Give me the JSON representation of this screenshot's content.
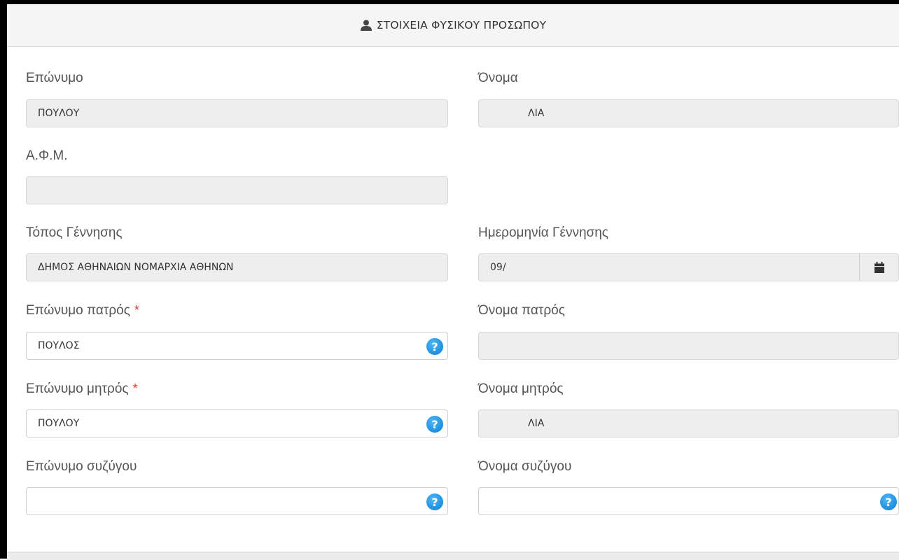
{
  "panel": {
    "title": "ΣΤΟΙΧΕΙΑ ΦΥΣΙΚΟΥ ΠΡΟΣΩΠΟΥ",
    "icon": "user-icon"
  },
  "fields": {
    "surname": {
      "label": "Επώνυμο",
      "value": "ΠΟΥΛΟΥ"
    },
    "first_name": {
      "label": "Όνομα",
      "value": "ΛΙΑ"
    },
    "afm": {
      "label": "Α.Φ.Μ.",
      "value": ""
    },
    "birth_place": {
      "label": "Τόπος Γέννησης",
      "value": "ΔΗΜΟΣ ΑΘΗΝΑΙΩΝ ΝΟΜΑΡΧΙΑ ΑΘΗΝΩΝ"
    },
    "birth_date": {
      "label": "Ημερομηνία Γέννησης",
      "value": "09/"
    },
    "father_surname": {
      "label": "Επώνυμο πατρός",
      "required": "*",
      "value": "ΠΟΥΛΟΣ"
    },
    "father_name": {
      "label": "Όνομα πατρός",
      "value": ""
    },
    "mother_surname": {
      "label": "Επώνυμο μητρός",
      "required": "*",
      "value": "ΠΟΥΛΟΥ"
    },
    "mother_name": {
      "label": "Όνομα μητρός",
      "value": "ΛΙΑ"
    },
    "spouse_surname": {
      "label": "Επώνυμο συζύγου",
      "value": ""
    },
    "spouse_name": {
      "label": "Όνομα συζύγου",
      "value": ""
    }
  },
  "help_glyph": "?",
  "colors": {
    "help": "#1d8fe0",
    "required": "#e0362d",
    "readonly_bg": "#eeeeee"
  }
}
